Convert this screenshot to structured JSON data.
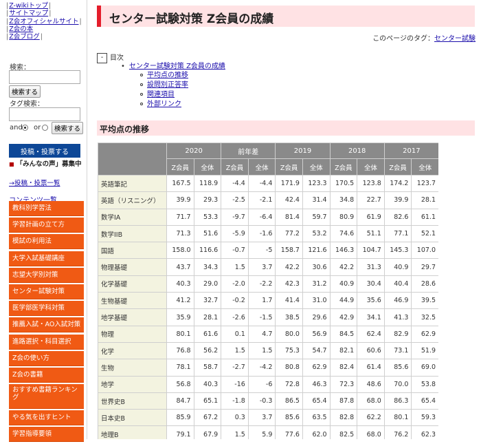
{
  "sidebar": {
    "top_links": [
      "Z-wikiトップ",
      "サイトマップ",
      "Z会オフィシャルサイト",
      "Z会の本",
      "Z会ブログ"
    ],
    "search_label": "検索：",
    "search_button": "検索する",
    "tag_search_label": "タグ検索：",
    "radio_and": "and",
    "radio_or": "or",
    "tag_search_button": "検索する",
    "post_button": "投稿・投票する",
    "minna_marker": "■",
    "minna_text": "「みんなの声」募集中",
    "toko_list_link": "→投稿・投票一覧",
    "contents_title": "コンテンツ一覧",
    "menu": [
      "教科別学習法",
      "学習計画の立て方",
      "模試の利用法",
      "大学入試基礎講座",
      "志望大学別対策",
      "センター試験対策",
      "医学部医学科対策",
      "推薦入試・AO入試対策",
      "進路選択・科目選択",
      "Z会の使い方",
      "Z会の書籍",
      "おすすめ書籍ランキング",
      "やる気を出すヒント",
      "学習指導要領"
    ]
  },
  "page": {
    "title": "センター試験対策 Z会員の成績",
    "tags_label": "このページのタグ：",
    "tag_link": "センター試験",
    "toc_toggle": "-",
    "toc_heading": "目次",
    "toc_main_bullet": "•",
    "toc_main": "センター試験対策 Z会員の成績",
    "toc_sub": [
      "平均点の推移",
      "設問別正答率",
      "関連項目",
      "外部リンク"
    ],
    "section_title": "平均点の推移"
  },
  "table": {
    "years": [
      "2020",
      "前年差",
      "2019",
      "2018",
      "2017"
    ],
    "sub_headers": [
      "Z会員",
      "全体",
      "Z会員",
      "全体",
      "Z会員",
      "全体",
      "Z会員",
      "全体",
      "Z会員",
      "全体"
    ],
    "rows": [
      {
        "subject": "英語筆記",
        "values": [
          "167.5",
          "118.9",
          "-4.4",
          "-4.4",
          "171.9",
          "123.3",
          "170.5",
          "123.8",
          "174.2",
          "123.7"
        ]
      },
      {
        "subject": "英語（リスニング）",
        "values": [
          "39.9",
          "29.3",
          "-2.5",
          "-2.1",
          "42.4",
          "31.4",
          "34.8",
          "22.7",
          "39.9",
          "28.1"
        ]
      },
      {
        "subject": "数学IA",
        "values": [
          "71.7",
          "53.3",
          "-9.7",
          "-6.4",
          "81.4",
          "59.7",
          "80.9",
          "61.9",
          "82.6",
          "61.1"
        ]
      },
      {
        "subject": "数学IIB",
        "values": [
          "71.3",
          "51.6",
          "-5.9",
          "-1.6",
          "77.2",
          "53.2",
          "74.6",
          "51.1",
          "77.1",
          "52.1"
        ]
      },
      {
        "subject": "国語",
        "values": [
          "158.0",
          "116.6",
          "-0.7",
          "-5",
          "158.7",
          "121.6",
          "146.3",
          "104.7",
          "145.3",
          "107.0"
        ]
      },
      {
        "subject": "物理基礎",
        "values": [
          "43.7",
          "34.3",
          "1.5",
          "3.7",
          "42.2",
          "30.6",
          "42.2",
          "31.3",
          "40.9",
          "29.7"
        ]
      },
      {
        "subject": "化学基礎",
        "values": [
          "40.3",
          "29.0",
          "-2.0",
          "-2.2",
          "42.3",
          "31.2",
          "40.9",
          "30.4",
          "40.4",
          "28.6"
        ]
      },
      {
        "subject": "生物基礎",
        "values": [
          "41.2",
          "32.7",
          "-0.2",
          "1.7",
          "41.4",
          "31.0",
          "44.9",
          "35.6",
          "46.9",
          "39.5"
        ]
      },
      {
        "subject": "地学基礎",
        "values": [
          "35.9",
          "28.1",
          "-2.6",
          "-1.5",
          "38.5",
          "29.6",
          "42.9",
          "34.1",
          "41.3",
          "32.5"
        ]
      },
      {
        "subject": "物理",
        "values": [
          "80.1",
          "61.6",
          "0.1",
          "4.7",
          "80.0",
          "56.9",
          "84.5",
          "62.4",
          "82.9",
          "62.9"
        ]
      },
      {
        "subject": "化学",
        "values": [
          "76.8",
          "56.2",
          "1.5",
          "1.5",
          "75.3",
          "54.7",
          "82.1",
          "60.6",
          "73.1",
          "51.9"
        ]
      },
      {
        "subject": "生物",
        "values": [
          "78.1",
          "58.7",
          "-2.7",
          "-4.2",
          "80.8",
          "62.9",
          "82.4",
          "61.4",
          "85.6",
          "69.0"
        ]
      },
      {
        "subject": "地学",
        "values": [
          "56.8",
          "40.3",
          "-16",
          "-6",
          "72.8",
          "46.3",
          "72.3",
          "48.6",
          "70.0",
          "53.8"
        ]
      },
      {
        "subject": "世界史B",
        "values": [
          "84.7",
          "65.1",
          "-1.8",
          "-0.3",
          "86.5",
          "65.4",
          "87.8",
          "68.0",
          "86.3",
          "65.4"
        ]
      },
      {
        "subject": "日本史B",
        "values": [
          "85.9",
          "67.2",
          "0.3",
          "3.7",
          "85.6",
          "63.5",
          "82.8",
          "62.2",
          "80.1",
          "59.3"
        ]
      },
      {
        "subject": "地理B",
        "values": [
          "79.1",
          "67.9",
          "1.5",
          "5.9",
          "77.6",
          "62.0",
          "82.5",
          "68.0",
          "76.2",
          "62.3"
        ]
      }
    ]
  }
}
